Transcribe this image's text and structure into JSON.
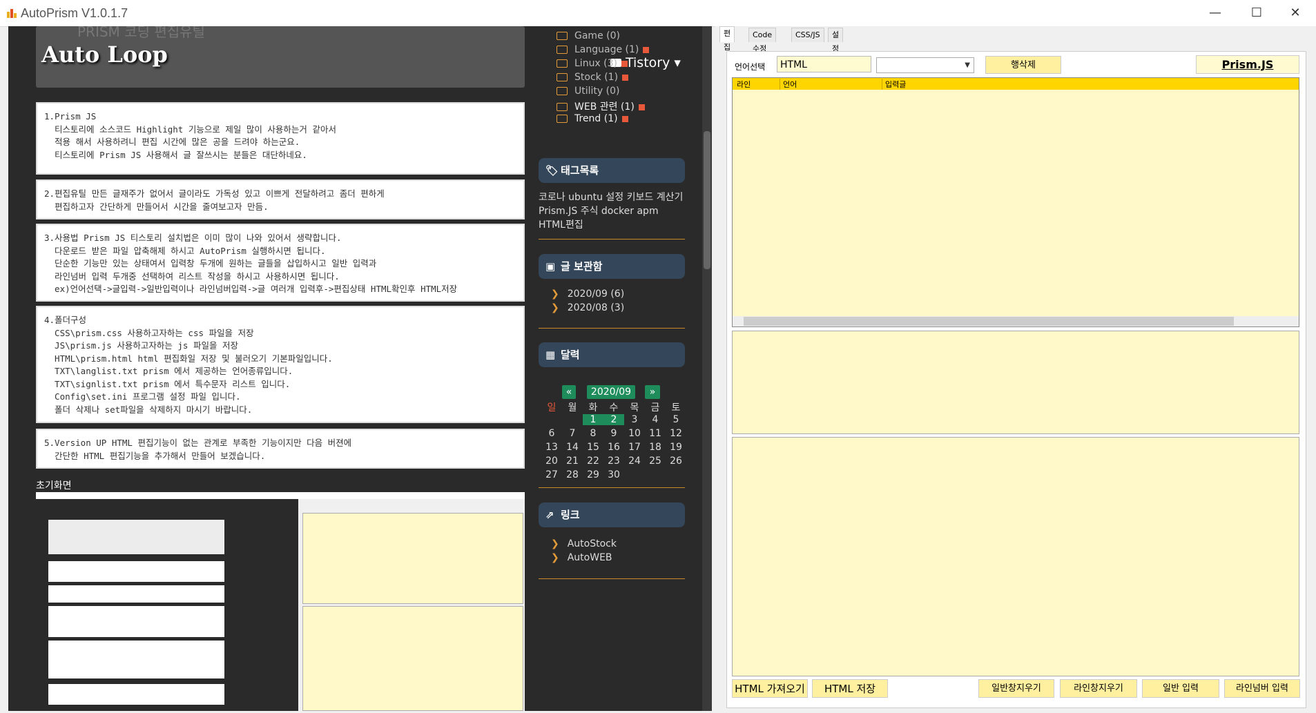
{
  "window": {
    "title": "AutoPrism V1.0.1.7",
    "minimize": "—",
    "maximize": "☐",
    "close": "✕"
  },
  "blog": {
    "title": "Auto Loop",
    "header_ghost": "PRISM 코딩 편집유틸",
    "tistory_label": "Tistory ▾",
    "cards": [
      "1.Prism JS\n  티스토리에 소스코드 Highlight 기능으로 제일 많이 사용하는거 같아서\n  적용 해서 사용하려니 편집 시간에 많은 공을 드려야 하는군요.\n  티스토리에 Prism JS 사용해서 글 잘쓰시는 분들은 대단하네요.",
      "2.편집유틸 만든 글재주가 없어서 글이라도 가독성 있고 이쁘게 전달하려고 좀더 편하게\n  편집하고자 간단하게 만들어서 시간을 줄여보고자 만듬.",
      "3.사용법 Prism JS 티스토리 설치법은 이미 많이 나와 있어서 생략합니다.\n  다운로드 받은 파일 압축해제 하시고 AutoPrism 실행하시면 됩니다.\n  단순한 기능만 있는 상태여서 입력창 두개에 원하는 글들을 삽입하시고 일반 입력과\n  라인넘버 입력 두개중 선택하여 리스트 작성을 하시고 사용하시면 됩니다.\n  ex)언어선택->글입력->일반입력이나 라인넘버입력->글 여러개 입력후->편집상태 HTML확인후 HTML저장",
      "4.폴더구성\n  CSS\\prism.css 사용하고자하는 css 파일을 저장\n  JS\\prism.js 사용하고자하는 js 파일을 저장\n  HTML\\prism.html html 편집화일 저장 및 불러오기 기본파일입니다.\n  TXT\\langlist.txt prism 에서 제공하는 언어종류입니다.\n  TXT\\signlist.txt prism 에서 특수문자 리스트 입니다.\n  Config\\set.ini 프로그램 설정 파일 입니다.\n  폴더 삭제나 set파일을 삭제하지 마시기 바랍니다.",
      "5.Version UP HTML 편집기능이 없는 관계로 부족한 기능이지만 다음 버젼에\n  간단한 HTML 편집기능을 추가해서 만들어 보겠습니다."
    ],
    "section_label": "초기화면",
    "categories": [
      "Game (0)",
      "Language (1)",
      "Linux (3)",
      "Stock (1)",
      "Utility (0)",
      "WEB 관련 (1)",
      "Trend (1)"
    ],
    "tags_heading": "태그목록",
    "tags": [
      "코로나 ubuntu 설정 키보드 계산기",
      "Prism.JS 주식 docker apm",
      "HTML편집"
    ],
    "archive_heading": "글 보관함",
    "archive": [
      "2020/09 (6)",
      "2020/08 (3)"
    ],
    "calendar_heading": "달력",
    "calendar": {
      "prev": "«",
      "month": "2020/09",
      "next": "»",
      "weekdays": [
        "일",
        "월",
        "화",
        "수",
        "목",
        "금",
        "토"
      ],
      "weeks": [
        [
          "",
          "",
          "1",
          "2",
          "3",
          "4",
          "5"
        ],
        [
          "6",
          "7",
          "8",
          "9",
          "10",
          "11",
          "12"
        ],
        [
          "13",
          "14",
          "15",
          "16",
          "17",
          "18",
          "19"
        ],
        [
          "20",
          "21",
          "22",
          "23",
          "24",
          "25",
          "26"
        ],
        [
          "27",
          "28",
          "29",
          "30",
          "",
          "",
          ""
        ]
      ]
    },
    "links_heading": "링크",
    "links": [
      "AutoStock",
      "AutoWEB"
    ]
  },
  "tool": {
    "tabs": [
      "편집",
      "Code 수정",
      "CSS/JS",
      "설정"
    ],
    "lang_label": "언어선택",
    "lang_value": "HTML",
    "delete_row": "행삭제",
    "prism_link": "Prism.JS",
    "grid_headers": [
      "라인",
      "언어",
      "입력글"
    ],
    "bottom_buttons": {
      "html_load": "HTML 가져오기",
      "html_save": "HTML 저장",
      "clear_normal": "일반창지우기",
      "clear_line": "라인창지우기",
      "normal_input": "일반 입력",
      "line_input": "라인넘버 입력"
    }
  }
}
